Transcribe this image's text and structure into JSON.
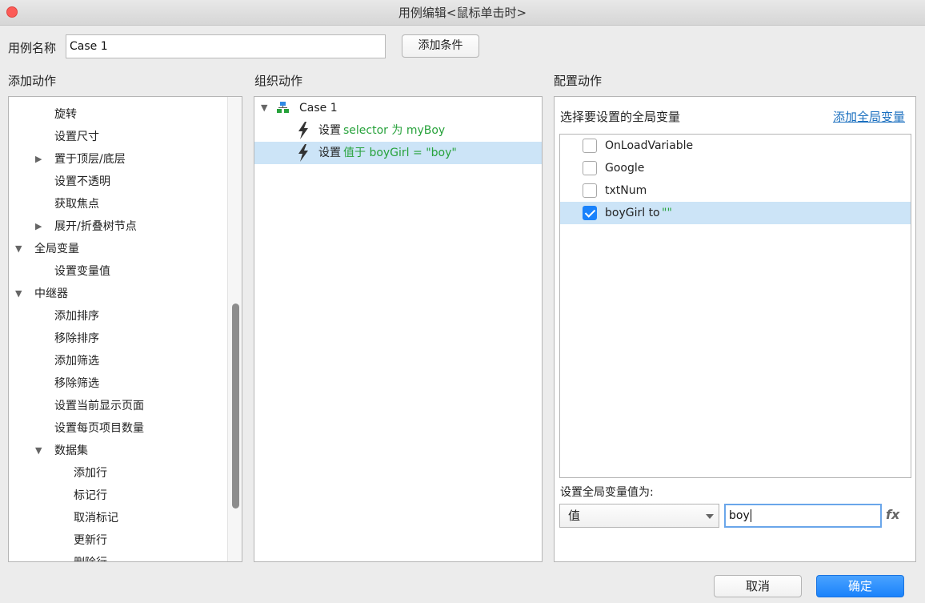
{
  "window": {
    "title": "用例编辑<鼠标单击时>"
  },
  "case": {
    "name_label": "用例名称",
    "name_value": "Case 1",
    "add_condition": "添加条件"
  },
  "add_actions": {
    "header": "添加动作",
    "items": [
      {
        "label": "旋转",
        "level": 2
      },
      {
        "label": "设置尺寸",
        "level": 2
      },
      {
        "label": "置于顶层/底层",
        "level": 2,
        "toggle": "collapsed"
      },
      {
        "label": "设置不透明",
        "level": 2
      },
      {
        "label": "获取焦点",
        "level": 2
      },
      {
        "label": "展开/折叠树节点",
        "level": 2,
        "toggle": "collapsed"
      },
      {
        "label": "全局变量",
        "level": 1,
        "toggle": "expanded"
      },
      {
        "label": "设置变量值",
        "level": 2
      },
      {
        "label": "中继器",
        "level": 1,
        "toggle": "expanded"
      },
      {
        "label": "添加排序",
        "level": 2
      },
      {
        "label": "移除排序",
        "level": 2
      },
      {
        "label": "添加筛选",
        "level": 2
      },
      {
        "label": "移除筛选",
        "level": 2
      },
      {
        "label": "设置当前显示页面",
        "level": 2
      },
      {
        "label": "设置每页项目数量",
        "level": 2
      },
      {
        "label": "数据集",
        "level": 2,
        "toggle": "expanded"
      },
      {
        "label": "添加行",
        "level": 3
      },
      {
        "label": "标记行",
        "level": 3
      },
      {
        "label": "取消标记",
        "level": 3
      },
      {
        "label": "更新行",
        "level": 3
      },
      {
        "label": "删除行",
        "level": 3
      }
    ]
  },
  "organize": {
    "header": "组织动作",
    "case_label": "Case 1",
    "actions": [
      {
        "prefix": "设置",
        "detail": "selector 为 myBoy"
      },
      {
        "prefix": "设置",
        "detail": "值于 boyGirl = \"boy\""
      }
    ]
  },
  "configure": {
    "header": "配置动作",
    "select_label": "选择要设置的全局变量",
    "add_var_link": "添加全局变量",
    "variables": [
      {
        "name": "OnLoadVariable",
        "checked": false
      },
      {
        "name": "Google",
        "checked": false
      },
      {
        "name": "txtNum",
        "checked": false
      },
      {
        "name": "boyGirl to",
        "suffix": "\"\"",
        "checked": true
      }
    ],
    "set_value_label": "设置全局变量值为:",
    "value_type": "值",
    "value_input": "boy",
    "fx_label": "fx"
  },
  "footer": {
    "cancel": "取消",
    "ok": "确定"
  },
  "colors": {
    "accent": "#1a82fb",
    "selection": "#cce4f7",
    "green_text": "#27a23b",
    "link": "#1a6fbf"
  }
}
